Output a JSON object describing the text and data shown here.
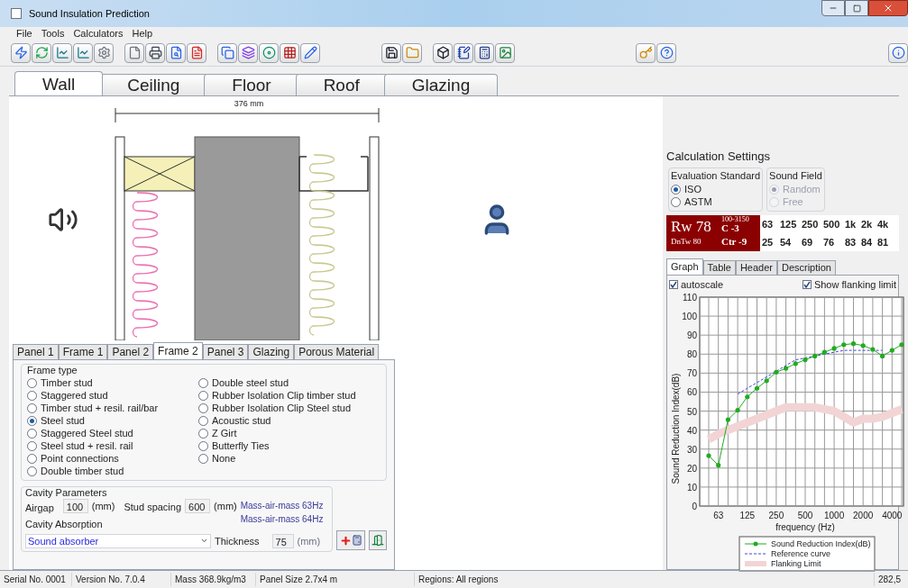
{
  "window": {
    "title": "Sound Insulation Prediction"
  },
  "menu": [
    "File",
    "Tools",
    "Calculators",
    "Help"
  ],
  "tabs": [
    {
      "label": "Wall",
      "selected": true
    },
    {
      "label": "Ceiling",
      "selected": false
    },
    {
      "label": "Floor",
      "selected": false
    },
    {
      "label": "Roof",
      "selected": false
    },
    {
      "label": "Glazing",
      "selected": false
    }
  ],
  "drawing": {
    "dimension": "376 mm"
  },
  "panel_tabs": [
    {
      "label": "Panel 1",
      "selected": false
    },
    {
      "label": "Frame 1",
      "selected": false
    },
    {
      "label": "Panel 2",
      "selected": false
    },
    {
      "label": "Frame 2",
      "selected": true
    },
    {
      "label": "Panel 3",
      "selected": false
    },
    {
      "label": "Glazing",
      "selected": false
    },
    {
      "label": "Porous Material",
      "selected": false
    }
  ],
  "frame_type": {
    "title": "Frame type",
    "columns": [
      [
        {
          "label": "Timber stud",
          "selected": false
        },
        {
          "label": "Staggered stud",
          "selected": false
        },
        {
          "label": "Timber stud + resil. rail/bar",
          "selected": false
        },
        {
          "label": "Steel stud",
          "selected": true
        },
        {
          "label": "Staggered Steel stud",
          "selected": false
        },
        {
          "label": "Steel stud + resil. rail",
          "selected": false
        },
        {
          "label": "Point connections",
          "selected": false
        },
        {
          "label": "Double timber stud",
          "selected": false
        }
      ],
      [
        {
          "label": "Double steel stud",
          "selected": false
        },
        {
          "label": "Rubber Isolation Clip timber stud",
          "selected": false
        },
        {
          "label": "Rubber Isolation Clip Steel stud",
          "selected": false
        },
        {
          "label": "Acoustic stud",
          "selected": false
        },
        {
          "label": "Z Girt",
          "selected": false
        },
        {
          "label": "Butterfly Ties",
          "selected": false
        },
        {
          "label": "None",
          "selected": false
        }
      ]
    ]
  },
  "cavity": {
    "title": "Cavity Parameters",
    "airgap_label": "Airgap",
    "airgap": "100",
    "airgap_unit": "(mm)",
    "spacing_label": "Stud spacing",
    "spacing": "600",
    "spacing_unit": "(mm)",
    "notes": [
      "Mass-air-mass 63Hz",
      "Mass-air-mass 64Hz"
    ],
    "absorption_label": "Cavity Absorption",
    "absorption": "Sound absorber",
    "thickness_label": "Thickness",
    "thickness": "75",
    "thickness_unit": "(mm)"
  },
  "calc": {
    "title": "Calculation Settings",
    "standard": {
      "title": "Evaluation Standard",
      "options": [
        {
          "label": "ISO",
          "selected": true,
          "disabled": false
        },
        {
          "label": "ASTM",
          "selected": false,
          "disabled": false
        }
      ]
    },
    "field": {
      "title": "Sound Field",
      "options": [
        {
          "label": "Random",
          "selected": true,
          "disabled": true
        },
        {
          "label": "Free",
          "selected": false,
          "disabled": true
        }
      ]
    },
    "rating": {
      "rw": "Rw 78",
      "range": "100-3150",
      "c": "C -3",
      "ctr": "Ctr -9",
      "dntw": "DnTw 80"
    },
    "bands": [
      "63",
      "125",
      "250",
      "500",
      "1k",
      "2k",
      "4k"
    ],
    "values": [
      "25",
      "54",
      "69",
      "76",
      "83",
      "84",
      "81"
    ]
  },
  "result_tabs": [
    {
      "label": "Graph",
      "selected": true
    },
    {
      "label": "Table",
      "selected": false
    },
    {
      "label": "Header",
      "selected": false
    },
    {
      "label": "Description",
      "selected": false
    }
  ],
  "options": [
    {
      "label": "autoscale",
      "checked": true
    },
    {
      "label": "Show flanking limit",
      "checked": true
    }
  ],
  "chart_data": {
    "type": "line",
    "xlabel": "frequency (Hz)",
    "ylabel": "Sound Reduction Index(dB)",
    "grid": true,
    "legend": "bottom",
    "categories": [
      null,
      "63",
      null,
      null,
      "125",
      null,
      null,
      "250",
      null,
      null,
      "500",
      null,
      null,
      "1000",
      null,
      null,
      "2000",
      null,
      null,
      "4000",
      null
    ],
    "ylim": [
      0,
      110
    ],
    "yticks": [
      0,
      10,
      20,
      30,
      40,
      50,
      60,
      70,
      80,
      90,
      100,
      110
    ],
    "series": [
      {
        "name": "Sound Reduction Index(dB)",
        "color": "#22aa22",
        "line_style": "solid",
        "values": [
          26.5,
          21.5,
          45.5,
          50.5,
          57.5,
          62,
          66,
          70.5,
          72.5,
          75,
          77,
          79,
          81,
          83,
          85,
          85.5,
          84.5,
          82.5,
          79,
          82,
          85
        ]
      },
      {
        "name": "Reference curve",
        "color": "#4444dd",
        "line_style": "dashed",
        "values": [
          null,
          null,
          null,
          59,
          62,
          65,
          68,
          71,
          74,
          77,
          78,
          79,
          80,
          81,
          82,
          82,
          82,
          82,
          82,
          null,
          null
        ]
      },
      {
        "name": "Flanking Limit",
        "color": "#f2d4d4",
        "line_style": "solid",
        "values": [
          35,
          38,
          40,
          42,
          44,
          46,
          48,
          50,
          52,
          52,
          52,
          52,
          51,
          50,
          47,
          44,
          46,
          46,
          47,
          49,
          51
        ]
      }
    ]
  },
  "status_bar": [
    "Serial No. 0001",
    "Version No. 7.0.4",
    "Mass 368.9kg/m3",
    "Panel Size 2.7x4 m",
    "Regions: All regions",
    "282,5"
  ]
}
